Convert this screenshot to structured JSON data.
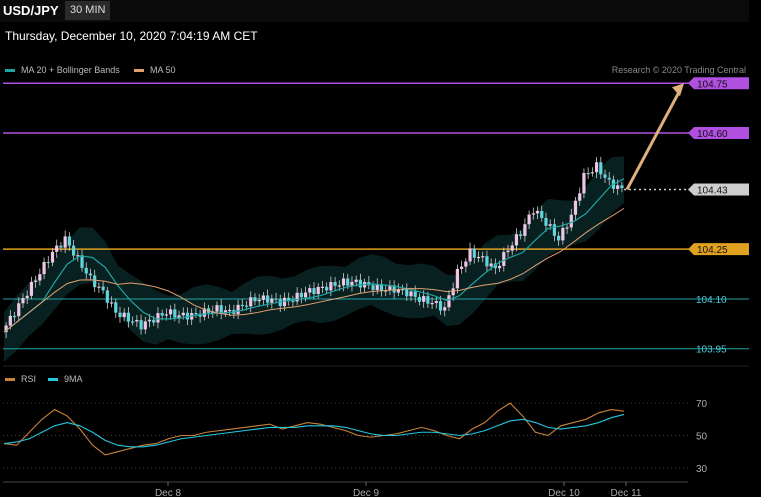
{
  "header": {
    "symbol": "USD/JPY",
    "timeframe": "30 MIN",
    "datetime": "Thursday, December 10, 2020 7:04:19 AM CET"
  },
  "legend": {
    "ma20": {
      "label": "MA 20 + Bollinger Bands",
      "color": "#1fa3a3"
    },
    "ma50": {
      "label": "MA 50",
      "color": "#e0a070"
    },
    "credit": "Research © 2020 Trading Central"
  },
  "rsi_legend": {
    "rsi": {
      "label": "RSI",
      "color": "#c8833a"
    },
    "ma9": {
      "label": "9MA",
      "color": "#22c8e0"
    }
  },
  "chart_data": [
    {
      "type": "line",
      "title": "",
      "ylim": [
        103.91,
        104.79
      ],
      "x_labels": [
        "Dec 8",
        "Dec 9",
        "Dec 10",
        "Dec 11"
      ],
      "levels": [
        {
          "value": 104.75,
          "label": "104.75",
          "style": "resistance",
          "color": "#b04fe0"
        },
        {
          "value": 104.6,
          "label": "104.60",
          "style": "resistance",
          "color": "#b04fe0"
        },
        {
          "value": 104.43,
          "label": "104.43",
          "style": "current",
          "color": "#cfcfcf"
        },
        {
          "value": 104.25,
          "label": "104.25",
          "style": "pivot",
          "color": "#e0a020"
        },
        {
          "value": 104.1,
          "label": "104.10",
          "style": "support",
          "color": "#1fa3a3"
        },
        {
          "value": 103.95,
          "label": "103.95",
          "style": "support",
          "color": "#1fa3a3"
        }
      ],
      "price_path": [
        104.0,
        104.06,
        104.12,
        104.18,
        104.24,
        104.28,
        104.22,
        104.16,
        104.12,
        104.06,
        104.04,
        104.02,
        104.04,
        104.06,
        104.05,
        104.05,
        104.06,
        104.07,
        104.06,
        104.08,
        104.1,
        104.1,
        104.09,
        104.1,
        104.12,
        104.13,
        104.14,
        104.15,
        104.15,
        104.14,
        104.13,
        104.13,
        104.12,
        104.1,
        104.09,
        104.07,
        104.18,
        104.24,
        104.22,
        104.19,
        104.25,
        104.3,
        104.37,
        104.33,
        104.28,
        104.35,
        104.47,
        104.5,
        104.45,
        104.43
      ],
      "projection": {
        "from": 104.43,
        "to": 104.75,
        "color": "#e0b07a"
      }
    },
    {
      "type": "line",
      "title": "RSI",
      "ylim": [
        25,
        75
      ],
      "y_ticks": [
        70,
        50,
        30
      ],
      "series": [
        {
          "name": "RSI",
          "values": [
            45,
            44,
            52,
            60,
            66,
            62,
            54,
            44,
            38,
            40,
            42,
            44,
            45,
            48,
            50,
            50,
            52,
            53,
            54,
            55,
            56,
            57,
            54,
            56,
            58,
            57,
            55,
            53,
            50,
            49,
            50,
            51,
            53,
            55,
            53,
            50,
            48,
            54,
            58,
            65,
            70,
            62,
            52,
            50,
            56,
            58,
            60,
            64,
            66,
            65
          ]
        },
        {
          "name": "9MA",
          "values": [
            45,
            46,
            48,
            52,
            56,
            58,
            56,
            52,
            47,
            44,
            43,
            43,
            44,
            46,
            48,
            49,
            50,
            51,
            52,
            53,
            54,
            55,
            55,
            55,
            56,
            56,
            56,
            55,
            53,
            51,
            50,
            50,
            51,
            52,
            52,
            51,
            50,
            51,
            53,
            56,
            59,
            60,
            58,
            55,
            54,
            55,
            56,
            58,
            61,
            63
          ]
        }
      ]
    }
  ]
}
